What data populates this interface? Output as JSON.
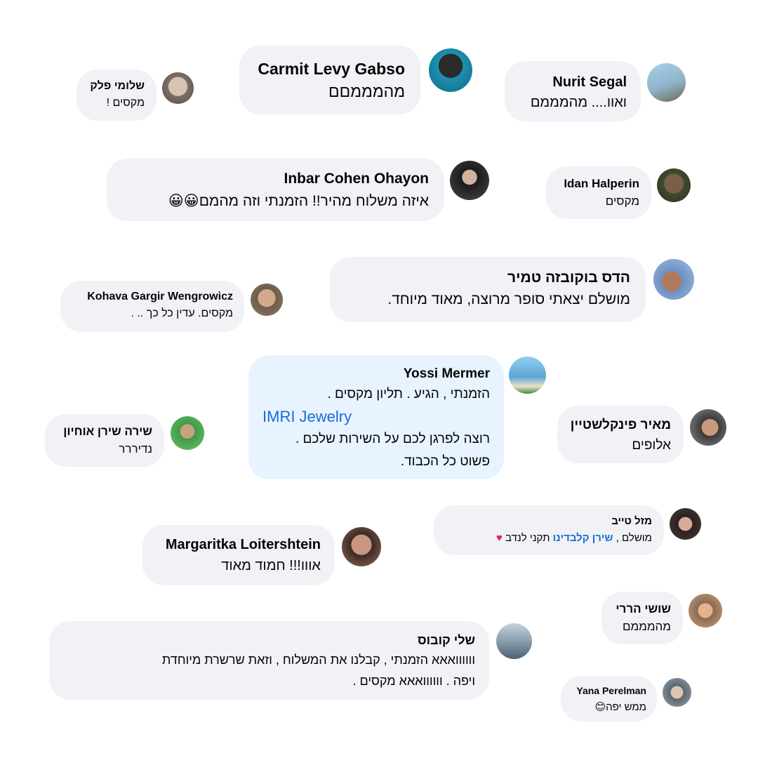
{
  "comments": {
    "nurit": {
      "name": "Nurit Segal",
      "text": "ואוו.... מהמממם",
      "avatar_color": "#8fb3c9"
    },
    "carmit": {
      "name": "Carmit Levy Gabso",
      "text": "מהמממםם",
      "avatar_color": "#1f8fb0"
    },
    "shlomi": {
      "name": "שלומי פלק",
      "text": "מקסים !",
      "avatar_color": "#a9968a"
    },
    "idan": {
      "name": "Idan Halperin",
      "text": "מקסים",
      "avatar_color": "#5a4a3a"
    },
    "inbar": {
      "name": "Inbar Cohen Ohayon",
      "text": "איזה משלוח מהיר!! הזמנתי וזה מהמם",
      "emoji": "😀😀",
      "avatar_color": "#3b3b3b"
    },
    "hadas": {
      "name": "הדס בוקובזה טמיר",
      "text": "מושלם יצאתי סופר מרוצה, מאוד מיוחד.",
      "avatar_color": "#6e8fc2"
    },
    "kohava": {
      "name": "Kohava Gargir Wengrowicz",
      "text": "מקסים. עדין כל כך .. .",
      "avatar_color": "#a08a6e"
    },
    "yossi": {
      "name": "Yossi Mermer",
      "line1": "הזמנתי , הגיע . תליון מקסים .",
      "link": "IMRI Jewelry",
      "line3": "רוצה לפרגן לכם על השירות שלכם .",
      "line4": "פשוט כל הכבוד.",
      "avatar_color": "#5fa6d6"
    },
    "meir": {
      "name": "מאיר פינקלשטיין",
      "text": "אלופים",
      "avatar_color": "#6a6a6a"
    },
    "shira": {
      "name": "שירה שירן אוחיון",
      "text": "נדיררר",
      "avatar_color": "#3f9a48"
    },
    "mazal": {
      "name": "מזל טייב",
      "text_before": "מושלם , ",
      "tag": "שירן קלבדינו",
      "text_after": " תקני לנדב",
      "heart": "♥",
      "avatar_color": "#4a3a36"
    },
    "margaritka": {
      "name": "Margaritka Loitershtein",
      "text": "אווו!!! חמוד מאוד",
      "avatar_color": "#9a6a55"
    },
    "shoshi": {
      "name": "שושי הררי",
      "text": "מהמממם",
      "avatar_color": "#c7a07a"
    },
    "shelly": {
      "name": "שלי קובוס",
      "line1": "וווווואאא הזמנתי , קבלנו את המשלוח , וזאת שרשרת מיוחדת",
      "line2": "ויפה . וווווואאא מקסים .",
      "avatar_color": "#6f8697"
    },
    "yana": {
      "name": "Yana Perelman",
      "text": "ממש יפה",
      "emoji": "😊",
      "avatar_color": "#9aa3ad"
    }
  }
}
